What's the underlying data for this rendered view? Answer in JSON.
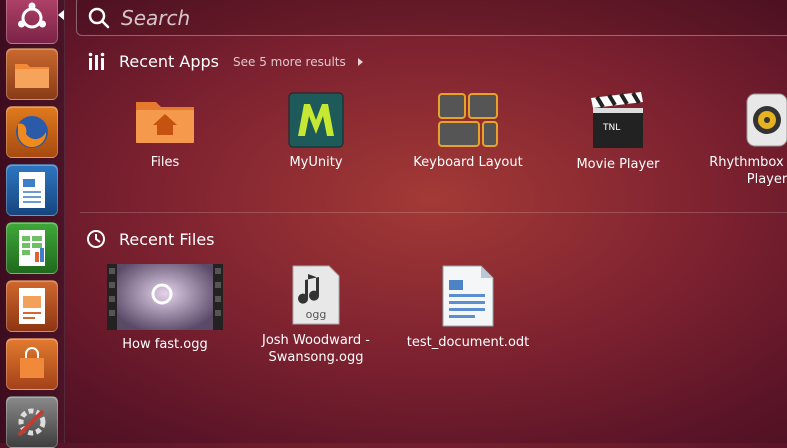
{
  "search": {
    "placeholder": "Search"
  },
  "launcher": {
    "items": [
      {
        "name": "Dash home"
      },
      {
        "name": "Files"
      },
      {
        "name": "Firefox Web Browser"
      },
      {
        "name": "LibreOffice Writer"
      },
      {
        "name": "LibreOffice Calc"
      },
      {
        "name": "LibreOffice Impress"
      },
      {
        "name": "Ubuntu Software Center"
      },
      {
        "name": "System Settings"
      }
    ]
  },
  "recent_apps": {
    "title": "Recent Apps",
    "more": "See 5 more results",
    "items": [
      {
        "label": "Files",
        "icon": "folder-home-icon"
      },
      {
        "label": "MyUnity",
        "icon": "myunity-icon"
      },
      {
        "label": "Keyboard Layout",
        "icon": "keyboard-layout-icon"
      },
      {
        "label": "Movie Player",
        "icon": "clapperboard-icon"
      },
      {
        "label": "Rhythmbox Music Player",
        "icon": "speaker-icon"
      }
    ]
  },
  "recent_files": {
    "title": "Recent Files",
    "items": [
      {
        "label": "How fast.ogg",
        "icon": "video-thumbnail-icon"
      },
      {
        "label": "Josh Woodward - Swansong.ogg",
        "icon": "audio-file-icon"
      },
      {
        "label": "test_document.odt",
        "icon": "text-document-icon"
      }
    ]
  }
}
